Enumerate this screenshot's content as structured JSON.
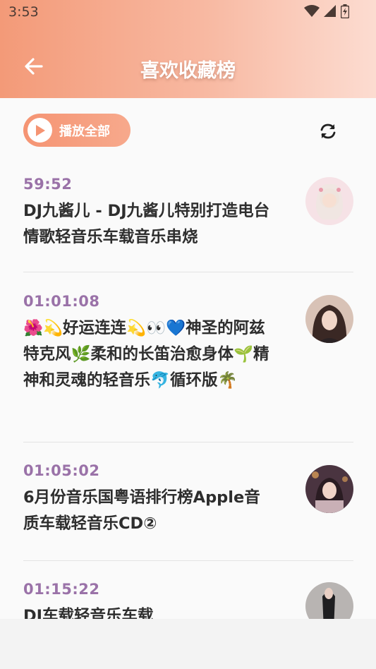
{
  "status_bar": {
    "time": "3:53"
  },
  "header": {
    "title": "喜欢收藏榜"
  },
  "toolbar": {
    "play_all_label": "播放全部"
  },
  "songs": [
    {
      "duration": "59:52",
      "title": "DJ九酱儿 - DJ九酱儿特别打造电台情歌轻音乐车载音乐串烧",
      "avatar_color": "#f6e2e6"
    },
    {
      "duration": "01:01:08",
      "title": "🌺💫好运连连💫👀💙神圣的阿兹特克风🌿柔和的长笛治愈身体🌱精神和灵魂的轻音乐🐬循环版🌴",
      "avatar_color": "#c9a08e"
    },
    {
      "duration": "01:05:02",
      "title": "6月份音乐国粤语排行榜Apple音质车载轻音乐CD②",
      "avatar_color": "#6a4a5a"
    },
    {
      "duration": "01:15:22",
      "title": "DJ车载轻音乐车载",
      "avatar_color": "#8a8a8a"
    }
  ],
  "colors": {
    "accent": "#f59473",
    "duration": "#9a72a8"
  }
}
